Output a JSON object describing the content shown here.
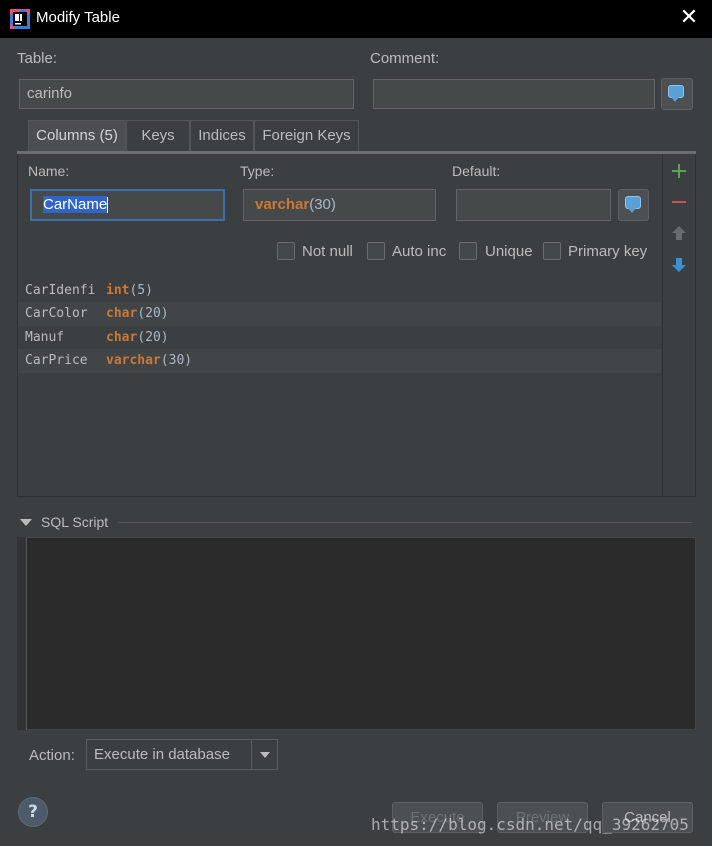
{
  "window": {
    "title": "Modify Table",
    "close_glyph": "✕"
  },
  "table": {
    "label": "Table:",
    "value": "carinfo"
  },
  "comment": {
    "label": "Comment:",
    "value": ""
  },
  "tabs": [
    {
      "label": "Columns (5)",
      "active": true
    },
    {
      "label": "Keys",
      "active": false
    },
    {
      "label": "Indices",
      "active": false
    },
    {
      "label": "Foreign Keys",
      "active": false
    }
  ],
  "column_editor": {
    "name_label": "Name:",
    "name_value": "CarName",
    "type_label": "Type:",
    "type_keyword": "varchar",
    "type_args": "(30)",
    "default_label": "Default:",
    "default_value": "",
    "checkboxes": [
      {
        "label": "Not null",
        "checked": false
      },
      {
        "label": "Auto inc",
        "checked": false
      },
      {
        "label": "Unique",
        "checked": false
      },
      {
        "label": "Primary key",
        "checked": false
      }
    ]
  },
  "columns": [
    {
      "name": "CarIdenfi",
      "type": "int",
      "args": "(5)"
    },
    {
      "name": "CarColor",
      "type": "char",
      "args": "(20)"
    },
    {
      "name": "Manuf",
      "type": "char",
      "args": "(20)"
    },
    {
      "name": "CarPrice",
      "type": "varchar",
      "args": "(30)"
    }
  ],
  "toolbar_icons": [
    "add-icon",
    "remove-icon",
    "move-up-icon",
    "move-down-icon"
  ],
  "sql_script": {
    "label": "SQL Script",
    "content": ""
  },
  "action": {
    "label": "Action:",
    "selected": "Execute in database"
  },
  "buttons": {
    "execute": "Execute",
    "preview": "Preview",
    "cancel": "Cancel",
    "help": "?"
  },
  "watermark": "https://blog.csdn.net/qq_39262705",
  "colors": {
    "keyword": "#cc7832",
    "selection": "#2f65ca",
    "add": "#5aa64a",
    "remove": "#c75450",
    "down": "#3d8fd1"
  }
}
